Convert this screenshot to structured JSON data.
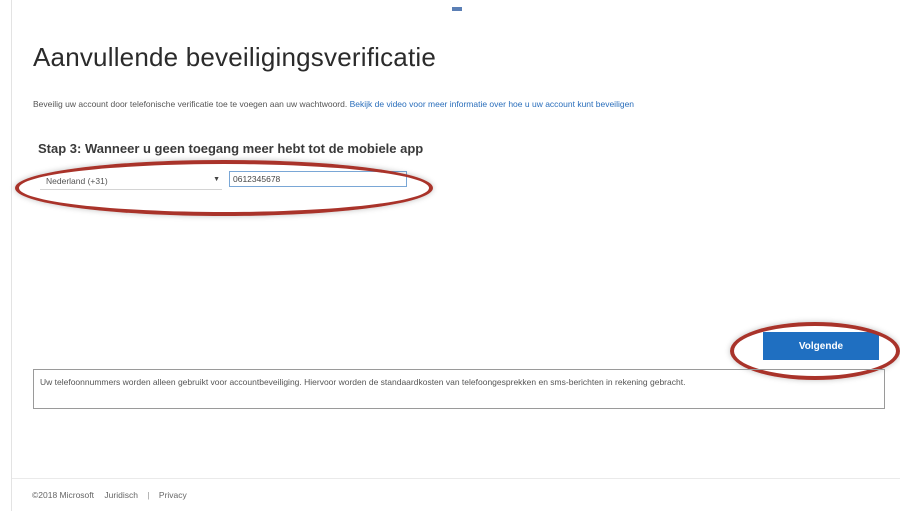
{
  "header": {
    "title": "Aanvullende beveiligingsverificatie"
  },
  "intro": {
    "text": "Beveilig uw account door telefonische verificatie toe te voegen aan uw wachtwoord.",
    "link": "Bekijk de video voor meer informatie over hoe u uw account kunt beveiligen"
  },
  "step": {
    "title": "Stap 3: Wanneer u geen toegang meer hebt tot de mobiele app"
  },
  "form": {
    "country_selected": "Nederland (+31)",
    "phone_value": "0612345678"
  },
  "actions": {
    "next_label": "Volgende"
  },
  "notice": {
    "text": "Uw telefoonnummers worden alleen gebruikt voor accountbeveiliging. Hiervoor worden de standaardkosten van telefoongesprekken en sms-berichten in rekening gebracht."
  },
  "footer": {
    "copyright": "©2018 Microsoft",
    "legal_link": "Juridisch",
    "separator": "|",
    "privacy_link": "Privacy"
  },
  "colors": {
    "accent": "#1f6fc1",
    "annotation_ring": "#a9332a",
    "link": "#2a6ebb"
  },
  "icons": {
    "dropdown": "chevron-down-icon"
  }
}
